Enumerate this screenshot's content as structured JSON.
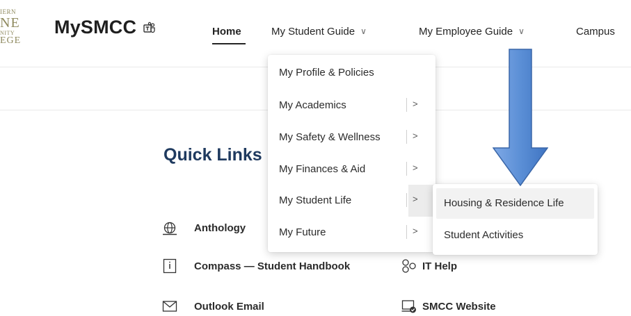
{
  "header": {
    "logo_lines": [
      "IERN",
      "NE",
      "NITY",
      "EGE"
    ],
    "site_title": "MySMCC",
    "nav": {
      "home": "Home",
      "student_guide": "My Student Guide",
      "employee_guide": "My Employee Guide",
      "campus": "Campus"
    }
  },
  "main": {
    "quick_links_title": "Quick Links",
    "links": {
      "anthology": "Anthology",
      "compass": "Compass — Student Handbook",
      "outlook": "Outlook Email",
      "it_help": "IT Help",
      "website": "SMCC Website"
    }
  },
  "student_guide_menu": {
    "items": [
      {
        "label": "My Profile & Policies"
      },
      {
        "label": "My Academics"
      },
      {
        "label": "My Safety & Wellness"
      },
      {
        "label": "My Finances & Aid"
      },
      {
        "label": "My Student Life"
      },
      {
        "label": "My Future"
      }
    ],
    "submenu": [
      {
        "label": "Housing & Residence Life"
      },
      {
        "label": "Student Activities"
      }
    ]
  },
  "annotation": {
    "arrow_color": "#5b8fd6"
  },
  "icons": {
    "chevron": "chevron-down-icon",
    "submenu_arrow": "chevron-right-icon"
  }
}
